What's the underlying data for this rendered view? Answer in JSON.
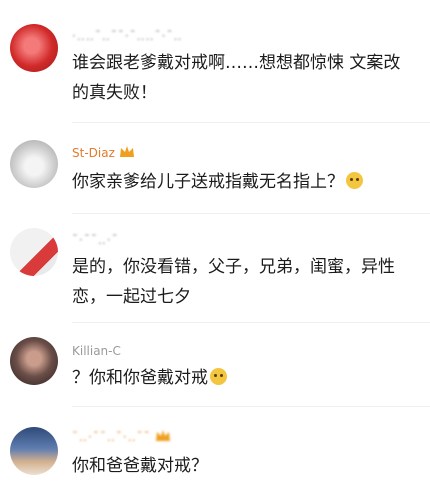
{
  "comments": [
    {
      "username": "·‥‥ˉ‥ˉˉ·ˉ‥‥ˉ·ˉ‥",
      "text": "谁会跟老爹戴对戒啊……想想都惊悚 文案改的真失败！",
      "avatar_colors": [
        "#d12a2a",
        "#f26b6b"
      ]
    },
    {
      "username": "St-Diaz",
      "text": "你家亲爹给儿子送戒指戴无名指上？",
      "badge_icon": "crown-badge-icon",
      "emoji_icon": "thinking-emoji-icon",
      "avatar_colors": [
        "#d8d8d8",
        "#eeeeee"
      ]
    },
    {
      "username": "ˉ·ˉˉ‥·ˉ",
      "text": "是的，你没看错，父子，兄弟，闺蜜，异性恋，一起过七夕",
      "avatar_colors": [
        "#e9e9e9",
        "#d93a3a"
      ]
    },
    {
      "username": "Killian-C",
      "text": "？你和你爸戴对戒",
      "emoji_icon": "sweat-smile-emoji-icon",
      "avatar_colors": [
        "#6b4e48",
        "#3a2c2a"
      ]
    },
    {
      "username": "ˉ‥·ˉˉ‥ˉ·‥ˉˉ",
      "text": "你和爸爸戴对戒？",
      "badge_icon": "crown-badge-icon",
      "avatar_colors": [
        "#3b5b8c",
        "#c8a88a"
      ]
    }
  ]
}
